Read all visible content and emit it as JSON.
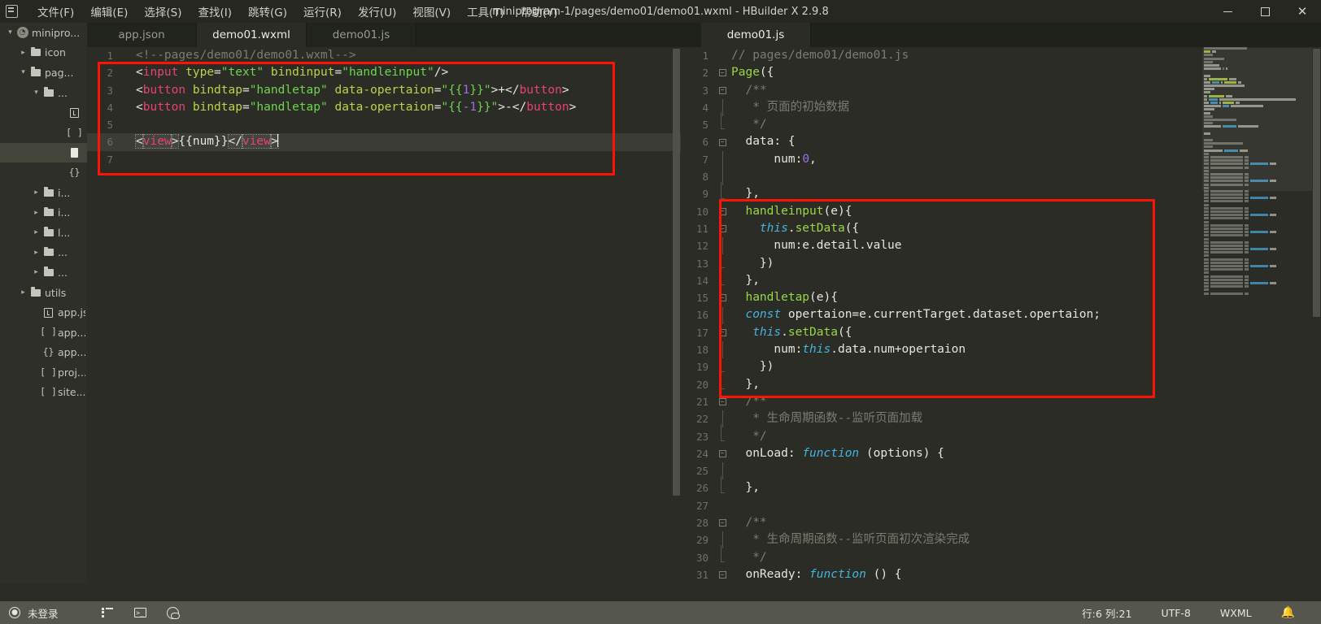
{
  "window": {
    "title": "miniprogram-1/pages/demo01/demo01.wxml - HBuilder X 2.9.8",
    "logo_name": "hbuilder-logo",
    "minimize": "—",
    "maximize": "□",
    "close": "✕"
  },
  "menubar": [
    {
      "label": "文件(F)",
      "name": "menu-file"
    },
    {
      "label": "编辑(E)",
      "name": "menu-edit"
    },
    {
      "label": "选择(S)",
      "name": "menu-select"
    },
    {
      "label": "查找(I)",
      "name": "menu-find"
    },
    {
      "label": "跳转(G)",
      "name": "menu-goto"
    },
    {
      "label": "运行(R)",
      "name": "menu-run"
    },
    {
      "label": "发行(U)",
      "name": "menu-publish"
    },
    {
      "label": "视图(V)",
      "name": "menu-view"
    },
    {
      "label": "工具(T)",
      "name": "menu-tools"
    },
    {
      "label": "帮助(Y)",
      "name": "menu-help"
    }
  ],
  "tabs_left": [
    {
      "label": "app.json",
      "active": false
    },
    {
      "label": "demo01.wxml",
      "active": true
    },
    {
      "label": "demo01.js",
      "active": false
    }
  ],
  "tabs_right": [
    {
      "label": "demo01.js",
      "active": true
    }
  ],
  "sidebar": {
    "items": [
      {
        "label": "minipro...",
        "icon": "project-icon",
        "arrow": "⌄",
        "indent": 0,
        "selected": false
      },
      {
        "label": "icon",
        "icon": "folder-icon",
        "arrow": "›",
        "indent": 1,
        "selected": false
      },
      {
        "label": "pag...",
        "icon": "folder-open-icon",
        "arrow": "⌄",
        "indent": 1,
        "selected": false
      },
      {
        "label": "...",
        "icon": "folder-open-icon",
        "arrow": "⌄",
        "indent": 2,
        "selected": false
      },
      {
        "label": "",
        "icon": "js-file-icon",
        "arrow": "",
        "indent": 4,
        "selected": false
      },
      {
        "label": "",
        "icon": "json-file-icon",
        "arrow": "",
        "indent": 4,
        "selected": false
      },
      {
        "label": "",
        "icon": "wxml-file-icon",
        "arrow": "",
        "indent": 4,
        "selected": true
      },
      {
        "label": "",
        "icon": "wxss-file-icon",
        "arrow": "",
        "indent": 4,
        "selected": false
      },
      {
        "label": "i...",
        "icon": "folder-icon",
        "arrow": "›",
        "indent": 2,
        "selected": false
      },
      {
        "label": "i...",
        "icon": "folder-icon",
        "arrow": "›",
        "indent": 2,
        "selected": false
      },
      {
        "label": "l...",
        "icon": "folder-icon",
        "arrow": "›",
        "indent": 2,
        "selected": false
      },
      {
        "label": "...",
        "icon": "folder-icon",
        "arrow": "›",
        "indent": 2,
        "selected": false
      },
      {
        "label": "...",
        "icon": "folder-icon",
        "arrow": "›",
        "indent": 2,
        "selected": false
      },
      {
        "label": "utils",
        "icon": "folder-icon",
        "arrow": "›",
        "indent": 1,
        "selected": false
      },
      {
        "label": "app.js",
        "icon": "js-file-icon",
        "arrow": "",
        "indent": 2,
        "selected": false
      },
      {
        "label": "app...",
        "icon": "json-file-icon",
        "arrow": "",
        "indent": 2,
        "selected": false
      },
      {
        "label": "app...",
        "icon": "wxss-file-icon",
        "arrow": "",
        "indent": 2,
        "selected": false
      },
      {
        "label": "proj...",
        "icon": "json-file-icon",
        "arrow": "",
        "indent": 2,
        "selected": false
      },
      {
        "label": "site...",
        "icon": "json-file-icon",
        "arrow": "",
        "indent": 2,
        "selected": false
      }
    ]
  },
  "editor_left": {
    "language": "WXML",
    "current_line": 6,
    "lines": [
      {
        "n": 1,
        "fold": "",
        "tokens": [
          {
            "t": "<!--pages/demo01/demo01.wxml-->",
            "c": "s-com"
          }
        ]
      },
      {
        "n": 2,
        "fold": "",
        "tokens": [
          {
            "t": "<",
            "c": "s-plain"
          },
          {
            "t": "input",
            "c": "s-tag"
          },
          {
            "t": " ",
            "c": "s-plain"
          },
          {
            "t": "type",
            "c": "s-attr"
          },
          {
            "t": "=",
            "c": "s-plain"
          },
          {
            "t": "\"text\"",
            "c": "s-str"
          },
          {
            "t": " ",
            "c": "s-plain"
          },
          {
            "t": "bindinput",
            "c": "s-attr"
          },
          {
            "t": "=",
            "c": "s-plain"
          },
          {
            "t": "\"handleinput\"",
            "c": "s-str"
          },
          {
            "t": "/>",
            "c": "s-plain"
          }
        ]
      },
      {
        "n": 3,
        "fold": "",
        "tokens": [
          {
            "t": "<",
            "c": "s-plain"
          },
          {
            "t": "button",
            "c": "s-tag"
          },
          {
            "t": " ",
            "c": "s-plain"
          },
          {
            "t": "bindtap",
            "c": "s-attr"
          },
          {
            "t": "=",
            "c": "s-plain"
          },
          {
            "t": "\"handletap\"",
            "c": "s-str"
          },
          {
            "t": " ",
            "c": "s-plain"
          },
          {
            "t": "data-opertaion",
            "c": "s-attr"
          },
          {
            "t": "=",
            "c": "s-plain"
          },
          {
            "t": "\"{{",
            "c": "s-str"
          },
          {
            "t": "1",
            "c": "s-num"
          },
          {
            "t": "}}\"",
            "c": "s-str"
          },
          {
            "t": ">+</",
            "c": "s-plain"
          },
          {
            "t": "button",
            "c": "s-tag"
          },
          {
            "t": ">",
            "c": "s-plain"
          }
        ]
      },
      {
        "n": 4,
        "fold": "",
        "tokens": [
          {
            "t": "<",
            "c": "s-plain"
          },
          {
            "t": "button",
            "c": "s-tag"
          },
          {
            "t": " ",
            "c": "s-plain"
          },
          {
            "t": "bindtap",
            "c": "s-attr"
          },
          {
            "t": "=",
            "c": "s-plain"
          },
          {
            "t": "\"handletap\"",
            "c": "s-str"
          },
          {
            "t": " ",
            "c": "s-plain"
          },
          {
            "t": "data-opertaion",
            "c": "s-attr"
          },
          {
            "t": "=",
            "c": "s-plain"
          },
          {
            "t": "\"{{",
            "c": "s-str"
          },
          {
            "t": "-1",
            "c": "s-num"
          },
          {
            "t": "}}\"",
            "c": "s-str"
          },
          {
            "t": ">-</",
            "c": "s-plain"
          },
          {
            "t": "button",
            "c": "s-tag"
          },
          {
            "t": ">",
            "c": "s-plain"
          }
        ]
      },
      {
        "n": 5,
        "fold": "",
        "tokens": []
      },
      {
        "n": 6,
        "fold": "",
        "current": true,
        "tokens": [
          {
            "t": "<",
            "c": "s-plain",
            "box": true
          },
          {
            "t": "view",
            "c": "s-tag",
            "box": true
          },
          {
            "t": ">",
            "c": "s-plain",
            "box": true
          },
          {
            "t": "{{num}}",
            "c": "s-plain"
          },
          {
            "t": "</",
            "c": "s-plain",
            "box": true
          },
          {
            "t": "view",
            "c": "s-tag",
            "box": true
          },
          {
            "t": ">",
            "c": "s-plain",
            "box": true
          },
          {
            "t": "",
            "c": "caret"
          }
        ]
      },
      {
        "n": 7,
        "fold": "",
        "tokens": []
      }
    ]
  },
  "editor_right": {
    "language": "JavaScript",
    "lines": [
      {
        "n": 1,
        "fold": "",
        "tokens": [
          {
            "t": "// pages/demo01/demo01.js",
            "c": "s-com"
          }
        ]
      },
      {
        "n": 2,
        "fold": "box",
        "tokens": [
          {
            "t": "Page",
            "c": "s-fn"
          },
          {
            "t": "({",
            "c": "s-plain"
          }
        ]
      },
      {
        "n": 3,
        "fold": "box",
        "tokens": [
          {
            "t": "  /**",
            "c": "s-com"
          }
        ]
      },
      {
        "n": 4,
        "fold": "bar",
        "tokens": [
          {
            "t": "   * 页面的初始数据",
            "c": "s-com"
          }
        ]
      },
      {
        "n": 5,
        "fold": "end",
        "tokens": [
          {
            "t": "   */",
            "c": "s-com"
          }
        ]
      },
      {
        "n": 6,
        "fold": "box",
        "tokens": [
          {
            "t": "  data: {",
            "c": "s-plain"
          }
        ]
      },
      {
        "n": 7,
        "fold": "bar",
        "tokens": [
          {
            "t": "      num:",
            "c": "s-plain"
          },
          {
            "t": "0",
            "c": "s-num"
          },
          {
            "t": ",",
            "c": "s-plain"
          }
        ]
      },
      {
        "n": 8,
        "fold": "bar",
        "tokens": []
      },
      {
        "n": 9,
        "fold": "end",
        "tokens": [
          {
            "t": "  },",
            "c": "s-plain"
          }
        ]
      },
      {
        "n": 10,
        "fold": "box",
        "tokens": [
          {
            "t": "  ",
            "c": "s-plain"
          },
          {
            "t": "handleinput",
            "c": "s-fn"
          },
          {
            "t": "(e){",
            "c": "s-plain"
          }
        ]
      },
      {
        "n": 11,
        "fold": "box",
        "tokens": [
          {
            "t": "    ",
            "c": "s-plain"
          },
          {
            "t": "this",
            "c": "s-kw"
          },
          {
            "t": ".",
            "c": "s-plain"
          },
          {
            "t": "setData",
            "c": "s-fn"
          },
          {
            "t": "({",
            "c": "s-plain"
          }
        ]
      },
      {
        "n": 12,
        "fold": "bar",
        "tokens": [
          {
            "t": "      num:e.detail.value",
            "c": "s-plain"
          }
        ]
      },
      {
        "n": 13,
        "fold": "end",
        "tokens": [
          {
            "t": "    })",
            "c": "s-plain"
          }
        ]
      },
      {
        "n": 14,
        "fold": "end",
        "tokens": [
          {
            "t": "  },",
            "c": "s-plain"
          }
        ]
      },
      {
        "n": 15,
        "fold": "box",
        "tokens": [
          {
            "t": "  ",
            "c": "s-plain"
          },
          {
            "t": "handletap",
            "c": "s-fn"
          },
          {
            "t": "(e){",
            "c": "s-plain"
          }
        ]
      },
      {
        "n": 16,
        "fold": "bar",
        "tokens": [
          {
            "t": "  ",
            "c": "s-plain"
          },
          {
            "t": "const",
            "c": "s-kw"
          },
          {
            "t": " opertaion=e.currentTarget.dataset.opertaion;",
            "c": "s-plain"
          }
        ]
      },
      {
        "n": 17,
        "fold": "box",
        "tokens": [
          {
            "t": "   ",
            "c": "s-plain"
          },
          {
            "t": "this",
            "c": "s-kw"
          },
          {
            "t": ".",
            "c": "s-plain"
          },
          {
            "t": "setData",
            "c": "s-fn"
          },
          {
            "t": "({",
            "c": "s-plain"
          }
        ]
      },
      {
        "n": 18,
        "fold": "bar",
        "tokens": [
          {
            "t": "      num:",
            "c": "s-plain"
          },
          {
            "t": "this",
            "c": "s-kw"
          },
          {
            "t": ".data.num+opertaion",
            "c": "s-plain"
          }
        ]
      },
      {
        "n": 19,
        "fold": "end",
        "tokens": [
          {
            "t": "    })",
            "c": "s-plain"
          }
        ]
      },
      {
        "n": 20,
        "fold": "end",
        "tokens": [
          {
            "t": "  },",
            "c": "s-plain"
          }
        ]
      },
      {
        "n": 21,
        "fold": "box",
        "tokens": [
          {
            "t": "  /**",
            "c": "s-com"
          }
        ]
      },
      {
        "n": 22,
        "fold": "bar",
        "tokens": [
          {
            "t": "   * 生命周期函数--监听页面加载",
            "c": "s-com"
          }
        ]
      },
      {
        "n": 23,
        "fold": "end",
        "tokens": [
          {
            "t": "   */",
            "c": "s-com"
          }
        ]
      },
      {
        "n": 24,
        "fold": "box",
        "tokens": [
          {
            "t": "  onLoad: ",
            "c": "s-plain"
          },
          {
            "t": "function",
            "c": "s-kw"
          },
          {
            "t": " (options) {",
            "c": "s-plain"
          }
        ]
      },
      {
        "n": 25,
        "fold": "bar",
        "tokens": []
      },
      {
        "n": 26,
        "fold": "end",
        "tokens": [
          {
            "t": "  },",
            "c": "s-plain"
          }
        ]
      },
      {
        "n": 27,
        "fold": "",
        "tokens": []
      },
      {
        "n": 28,
        "fold": "box",
        "tokens": [
          {
            "t": "  /**",
            "c": "s-com"
          }
        ]
      },
      {
        "n": 29,
        "fold": "bar",
        "tokens": [
          {
            "t": "   * 生命周期函数--监听页面初次渲染完成",
            "c": "s-com"
          }
        ]
      },
      {
        "n": 30,
        "fold": "end",
        "tokens": [
          {
            "t": "   */",
            "c": "s-com"
          }
        ]
      },
      {
        "n": 31,
        "fold": "box",
        "tokens": [
          {
            "t": "  onReady: ",
            "c": "s-plain"
          },
          {
            "t": "function",
            "c": "s-kw"
          },
          {
            "t": " () {",
            "c": "s-plain"
          }
        ]
      }
    ]
  },
  "annotations": [
    {
      "name": "wxml-highlight-box",
      "color": "#fc1404"
    },
    {
      "name": "js-handlers-highlight-box",
      "color": "#fc1404"
    }
  ],
  "statusbar": {
    "login_label": "未登录",
    "login_icon": "user-circle-icon",
    "icons": [
      "outline-list-icon",
      "terminal-icon",
      "browser-globe-icon"
    ],
    "line_col": "行:6  列:21",
    "encoding": "UTF-8",
    "language": "WXML",
    "bell": "🔔"
  },
  "colors": {
    "background": "#2a2c25",
    "chrome": "#252720",
    "sidebar": "#2d2f28",
    "statusbar": "#55564e",
    "accent_red": "#fc1404",
    "tag": "#e8417a",
    "attr": "#b8d44b",
    "string": "#6fd44f",
    "keyword": "#44b3e0",
    "comment": "#7b7d72",
    "number": "#9d6ee8",
    "function": "#9ad648"
  }
}
